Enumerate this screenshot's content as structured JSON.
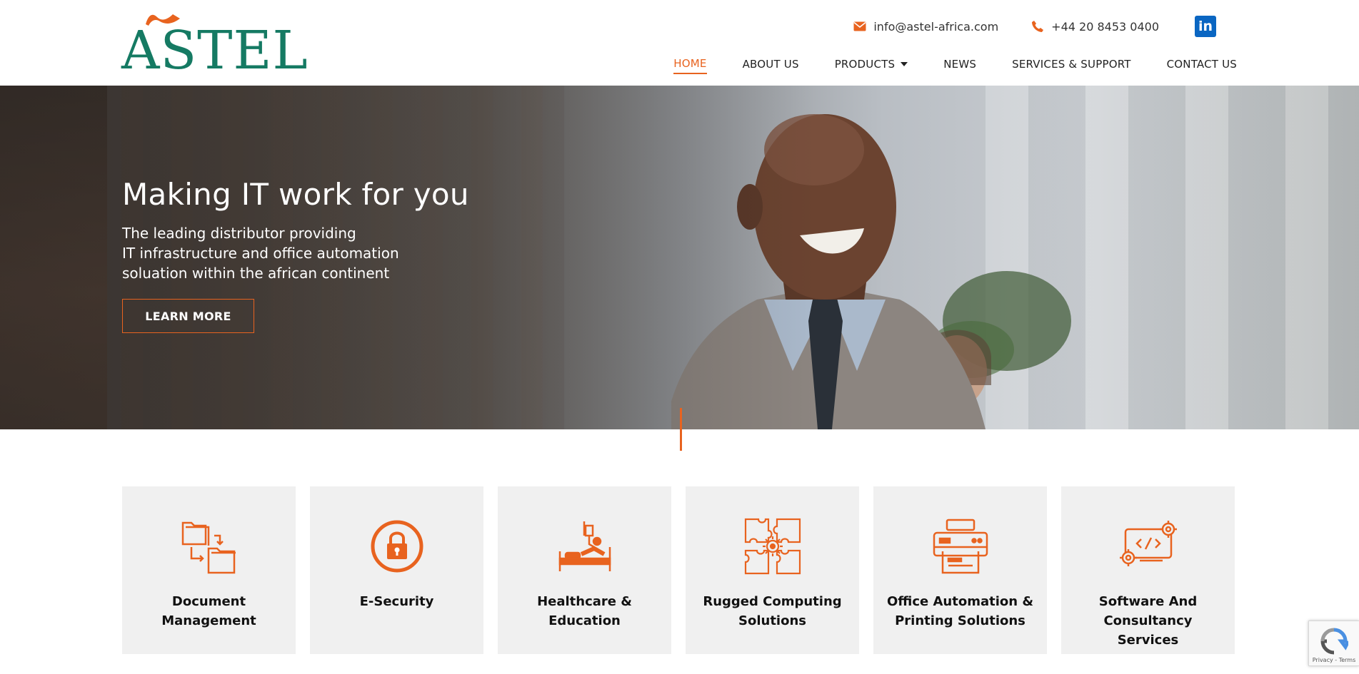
{
  "brand": {
    "logo_text": "ASTEL",
    "logo_color": "#157a63",
    "flag_color": "#e8631f"
  },
  "contact": {
    "email": "info@astel-africa.com",
    "phone": "+44 20 8453 0400",
    "social_icon": "linkedin-icon"
  },
  "nav": {
    "items": [
      {
        "label": "HOME",
        "active": true
      },
      {
        "label": "ABOUT US"
      },
      {
        "label": "PRODUCTS",
        "has_dropdown": true
      },
      {
        "label": "NEWS"
      },
      {
        "label": "SERVICES & SUPPORT"
      },
      {
        "label": "CONTACT US"
      }
    ]
  },
  "hero": {
    "title": "Making IT work for you",
    "subtitle_lines": [
      "The leading distributor providing",
      "IT infrastructure and office automation",
      "soluation within the african continent"
    ],
    "button_label": "LEARN MORE"
  },
  "services": [
    {
      "label_lines": [
        "Document",
        "Management"
      ],
      "icon": "folders-icon"
    },
    {
      "label_lines": [
        "E-Security"
      ],
      "icon": "lock-icon"
    },
    {
      "label_lines": [
        "Healthcare & Education"
      ],
      "icon": "hospital-bed-icon"
    },
    {
      "label_lines": [
        "Rugged Computing",
        "Solutions"
      ],
      "icon": "puzzle-gear-icon"
    },
    {
      "label_lines": [
        "Office Automation &",
        "Printing Solutions"
      ],
      "icon": "printer-icon"
    },
    {
      "label_lines": [
        "Software And",
        "Consultancy Services"
      ],
      "icon": "code-monitor-icon"
    }
  ],
  "recaptcha": {
    "text": "Privacy - Terms"
  },
  "colors": {
    "accent": "#e8631f",
    "card_bg": "#f0f0f0"
  }
}
